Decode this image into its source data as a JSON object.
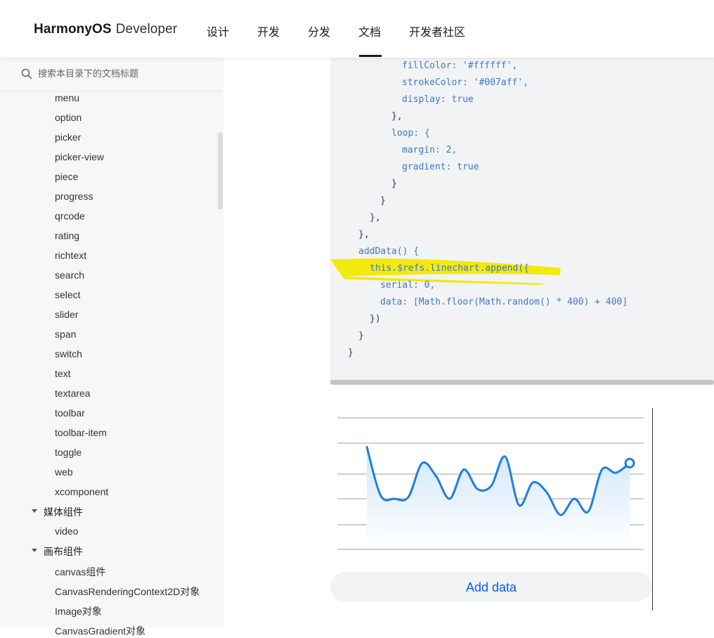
{
  "header": {
    "logo_brand": "HarmonyOS",
    "logo_suffix": "Developer",
    "nav": [
      "设计",
      "开发",
      "分发",
      "文档",
      "开发者社区"
    ],
    "active_nav": "文档"
  },
  "sidebar": {
    "search_placeholder": "搜索本目录下的文档标题",
    "items": [
      "menu",
      "option",
      "picker",
      "picker-view",
      "piece",
      "progress",
      "qrcode",
      "rating",
      "richtext",
      "search",
      "select",
      "slider",
      "span",
      "switch",
      "text",
      "textarea",
      "toolbar",
      "toolbar-item",
      "toggle",
      "web",
      "xcomponent"
    ],
    "group_media": "媒体组件",
    "media_items": [
      "video"
    ],
    "group_canvas": "画布组件",
    "canvas_items": [
      "canvas组件",
      "CanvasRenderingContext2D对象",
      "Image对象",
      "CanvasGradient对象"
    ]
  },
  "code": {
    "lines": [
      "fillColor: '#ffffff',",
      "strokeColor: '#007aff',",
      "display: true",
      "},",
      "loop: {",
      "margin: 2,",
      "gradient: true",
      "}",
      "}",
      "},",
      "},",
      "addData() {",
      "this.$refs.linechart.append({",
      "serial: 0,",
      "data: [Math.floor(Math.random() * 400) + 400]",
      "})",
      "}",
      "}"
    ]
  },
  "chart_data": {
    "type": "line",
    "series": [
      {
        "values": [
          610,
          460,
          450,
          455,
          560,
          520,
          450,
          540,
          480,
          490,
          580,
          430,
          500,
          470,
          400,
          450,
          410,
          540,
          530,
          560
        ]
      }
    ],
    "ylim": [
      300,
      700
    ],
    "grid": true,
    "line_color": "#1f7ee0",
    "fill_color_top": "#cfe6fb",
    "fill_color_bottom": "#ffffff"
  },
  "add_button": {
    "label": "Add data"
  }
}
